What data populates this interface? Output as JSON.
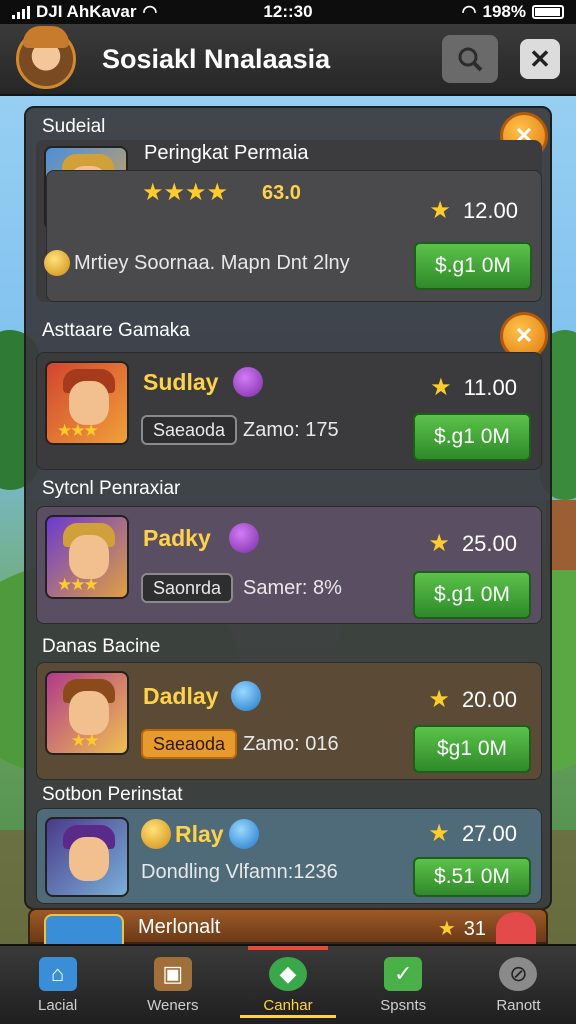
{
  "status_bar": {
    "carrier": "DJI AhKavar",
    "time": "12::30",
    "battery": "198%"
  },
  "header": {
    "title": "Sosiakl Nnalaasia",
    "search_icon": "search-icon",
    "close_icon": "close-icon"
  },
  "sections": [
    {
      "title": "Sudeial",
      "card": {
        "name": "Peringkat Permaia",
        "stars": "★★★★",
        "score": "63.0",
        "description": "Mrtiey Soornaa. Mapn Dnt 2lny",
        "rating": "12.00",
        "price": "$.g1 0M"
      }
    },
    {
      "title": "Asttaare Gamaka",
      "card": {
        "name": "Sudlay",
        "tag": "Saeaoda",
        "meta": "Zamo: 175",
        "rating": "11.00",
        "price": "$.g1 0M",
        "thumb_stars": "★★★"
      }
    },
    {
      "title": "Sytcnl Penraxiar",
      "card": {
        "name": "Padky",
        "tag": "Saonrda",
        "meta": "Samer: 8%",
        "rating": "25.00",
        "price": "$.g1 0M",
        "thumb_stars": "★★★"
      }
    },
    {
      "title": "Danas Bacine",
      "card": {
        "name": "Dadlay",
        "tag": "Saeaoda",
        "meta": "Zamo: 016",
        "rating": "20.00",
        "price": "$g1 0M",
        "thumb_stars": "★★"
      }
    },
    {
      "title": "Sotbon Perinstat",
      "card": {
        "name": "Rlay",
        "meta": "Dondling Vlfamn:1236",
        "rating": "27.00",
        "price": "$.51 0M"
      }
    }
  ],
  "peek_card": {
    "title": "Merlonalt",
    "rating": "31"
  },
  "nav": [
    {
      "label": "Lacial",
      "icon": "home-icon"
    },
    {
      "label": "Weners",
      "icon": "shop-icon"
    },
    {
      "label": "Canhar",
      "icon": "gem-icon"
    },
    {
      "label": "Spsnts",
      "icon": "check-icon"
    },
    {
      "label": "Ranott",
      "icon": "compass-icon"
    }
  ]
}
